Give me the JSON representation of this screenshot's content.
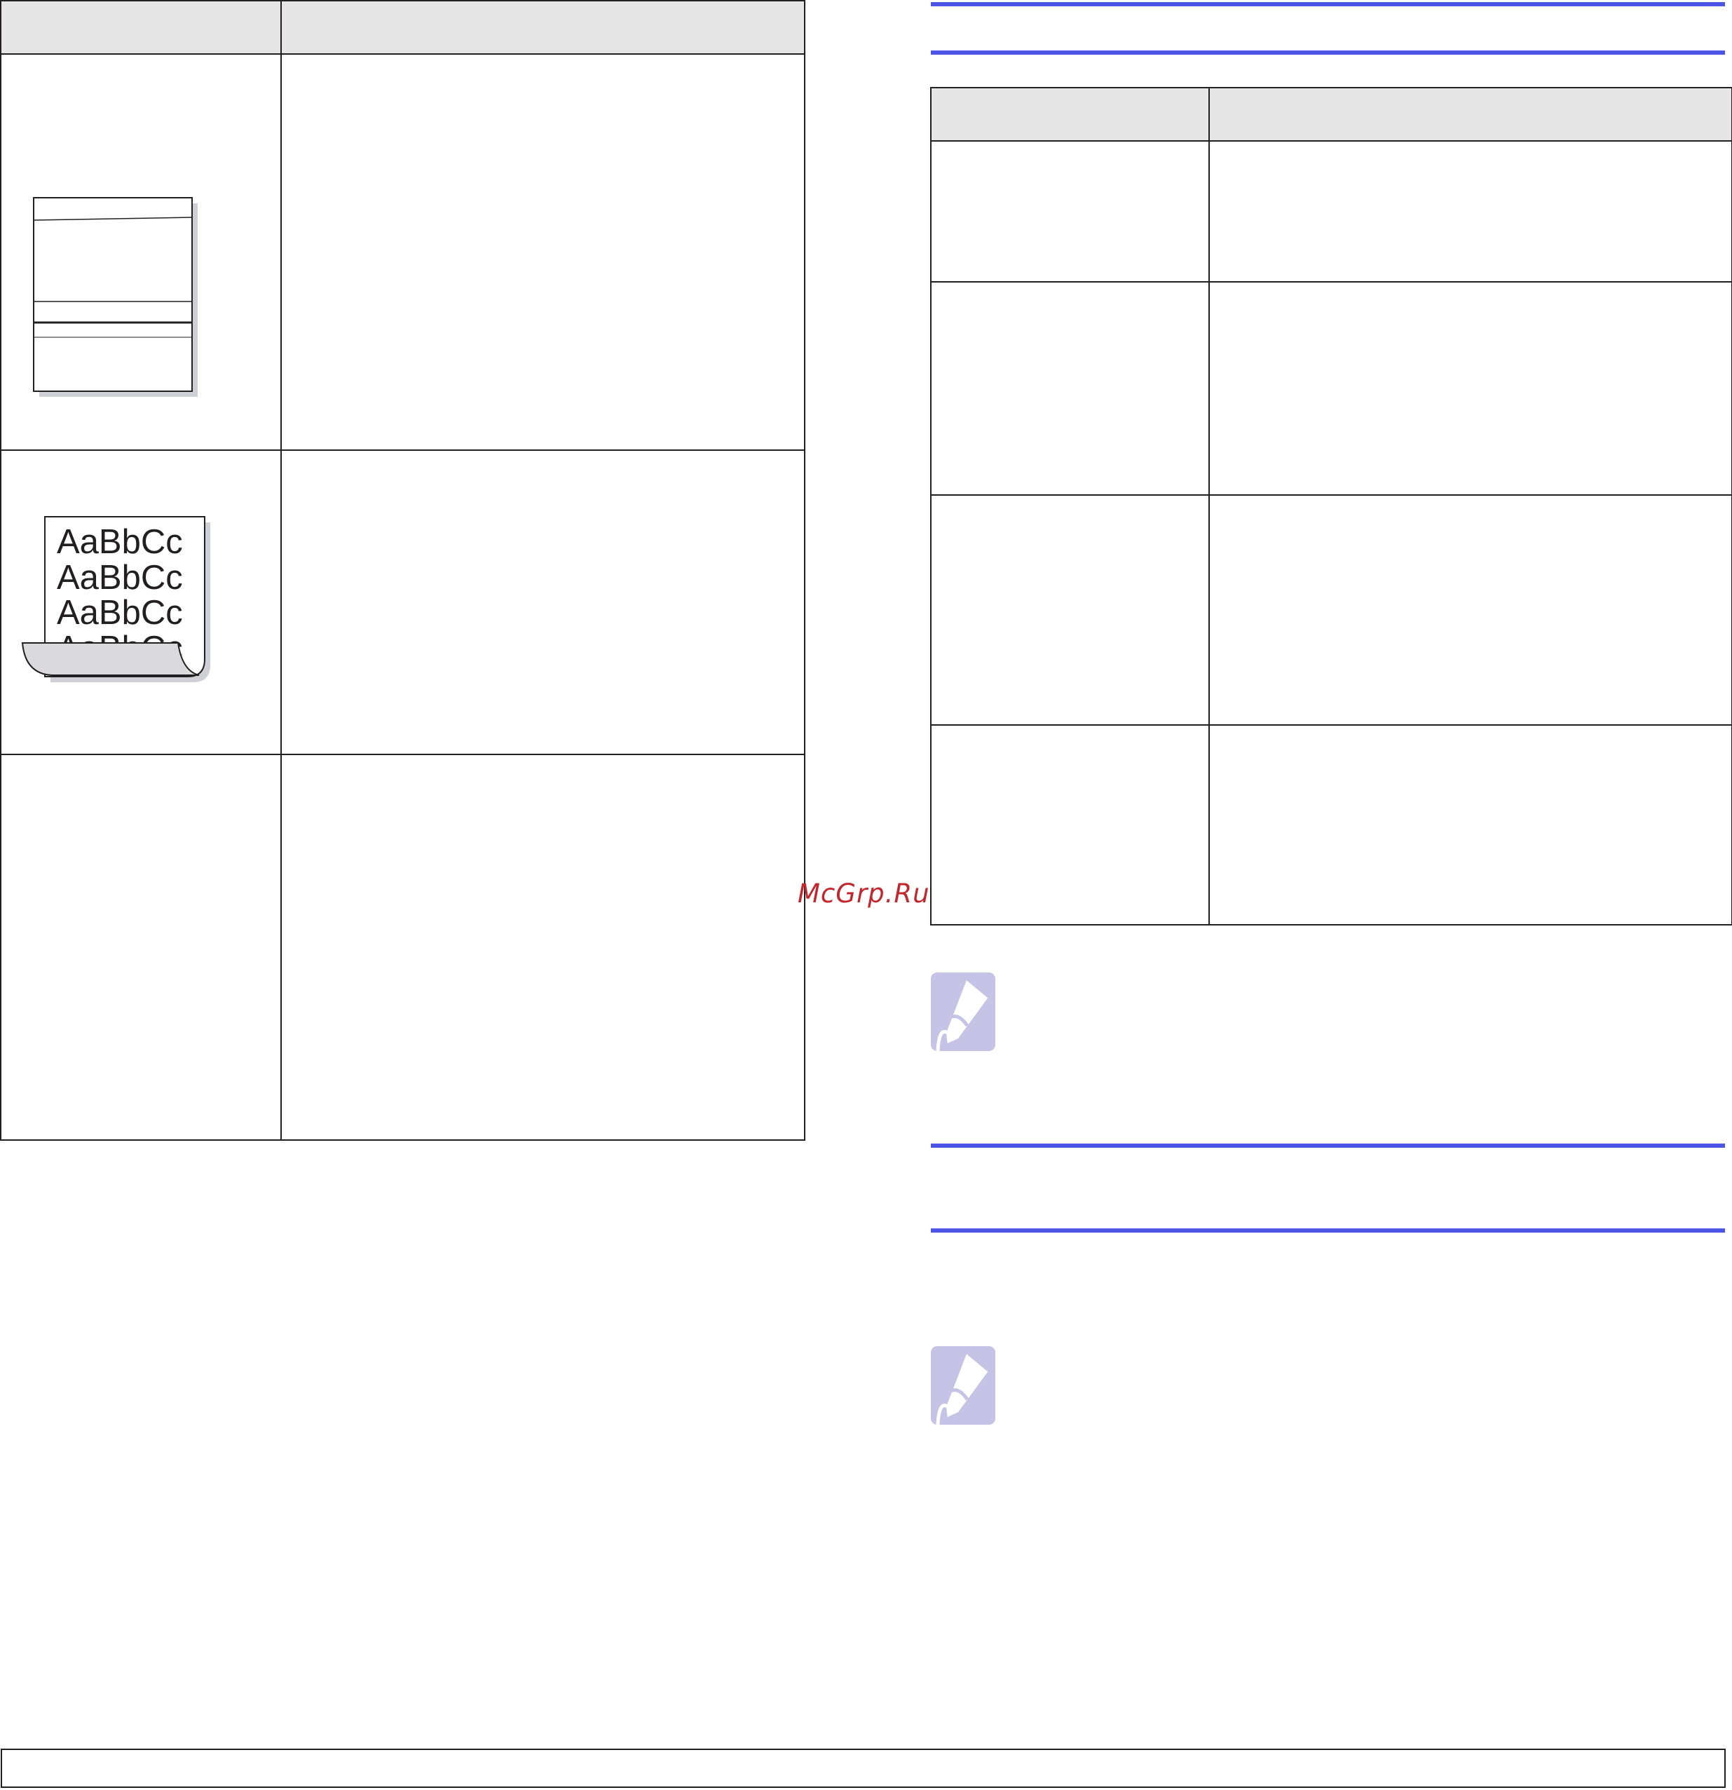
{
  "watermark": {
    "text": "McGrp.Ru"
  },
  "sample_text": {
    "lines": [
      "AaBbCc",
      "AaBbCc",
      "AaBbCc",
      "AaBbCc"
    ]
  },
  "icons": {
    "banding_sample": "horizontal-bands-page-icon",
    "curl_sample": "curled-page-icon",
    "note": "note-pencil-icon"
  },
  "colors": {
    "rule_blue": "#4b56e8",
    "header_gray": "#e6e6e6",
    "note_lavender": "#c5c4e6",
    "watermark_red": "#c1272d"
  }
}
